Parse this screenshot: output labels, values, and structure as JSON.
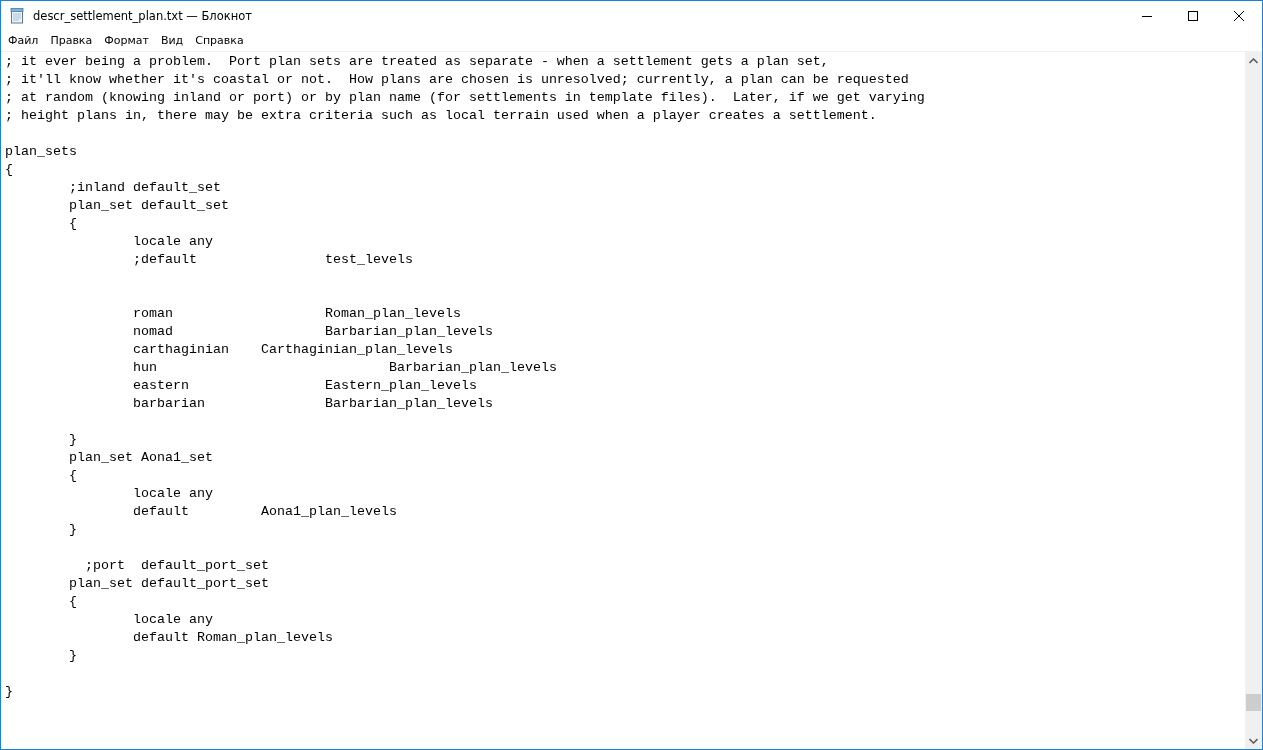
{
  "window": {
    "title": "descr_settlement_plan.txt — Блокнот"
  },
  "menu": [
    {
      "label": "Файл"
    },
    {
      "label": "Правка"
    },
    {
      "label": "Формат"
    },
    {
      "label": "Вид"
    },
    {
      "label": "Справка"
    }
  ],
  "lines": [
    {
      "kind": "text",
      "text": "; it ever being a problem.  Port plan sets are treated as separate - when a settlement gets a plan set,"
    },
    {
      "kind": "text",
      "text": "; it'll know whether it's coastal or not.  How plans are chosen is unresolved; currently, a plan can be requested"
    },
    {
      "kind": "text",
      "text": "; at random (knowing inland or port) or by plan name (for settlements in template files).  Later, if we get varying"
    },
    {
      "kind": "text",
      "text": "; height plans in, there may be extra criteria such as local terrain used when a player creates a settlement."
    },
    {
      "kind": "blank"
    },
    {
      "kind": "text",
      "text": "plan_sets"
    },
    {
      "kind": "text",
      "text": "{"
    },
    {
      "kind": "text",
      "text": "\t;inland default_set"
    },
    {
      "kind": "text",
      "text": "\tplan_set default_set"
    },
    {
      "kind": "text",
      "text": "\t{"
    },
    {
      "kind": "text",
      "text": "\t\tlocale any"
    },
    {
      "kind": "text",
      "text": "\t\t;default\t\ttest_levels"
    },
    {
      "kind": "blank"
    },
    {
      "kind": "blank"
    },
    {
      "kind": "text",
      "text": "\t\troman\t\t\tRoman_plan_levels"
    },
    {
      "kind": "text",
      "text": "\t\tnomad\t\t\tBarbarian_plan_levels"
    },
    {
      "kind": "text",
      "text": "\t\tcarthaginian\tCarthaginian_plan_levels"
    },
    {
      "kind": "text",
      "text": "\t\thun\t\t\t\tBarbarian_plan_levels"
    },
    {
      "kind": "text",
      "text": "\t\teastern\t\t\tEastern_plan_levels"
    },
    {
      "kind": "text",
      "text": "\t\tbarbarian\t\tBarbarian_plan_levels"
    },
    {
      "kind": "blank"
    },
    {
      "kind": "text",
      "text": "\t}"
    },
    {
      "kind": "text",
      "text": "\tplan_set Aona1_set"
    },
    {
      "kind": "text",
      "text": "\t{"
    },
    {
      "kind": "text",
      "text": "\t\tlocale any"
    },
    {
      "kind": "text",
      "text": "\t\tdefault\t\tAona1_plan_levels"
    },
    {
      "kind": "text",
      "text": "\t}"
    },
    {
      "kind": "blank"
    },
    {
      "kind": "text",
      "text": "\t  ;port  default_port_set"
    },
    {
      "kind": "text",
      "text": "\tplan_set default_port_set"
    },
    {
      "kind": "text",
      "text": "\t{"
    },
    {
      "kind": "text",
      "text": "\t\tlocale any"
    },
    {
      "kind": "text",
      "text": "\t\tdefault Roman_plan_levels"
    },
    {
      "kind": "text",
      "text": "\t}"
    },
    {
      "kind": "blank"
    },
    {
      "kind": "text",
      "text": "}"
    }
  ]
}
